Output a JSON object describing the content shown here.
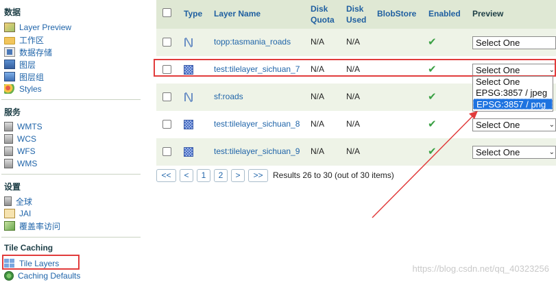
{
  "sidebar": {
    "data_section": {
      "title": "数据",
      "items": [
        {
          "label": "Layer Preview",
          "icon": "layer-preview-icon"
        },
        {
          "label": "工作区",
          "icon": "folder-icon"
        },
        {
          "label": "数据存储",
          "icon": "datastore-icon"
        },
        {
          "label": "图层",
          "icon": "layer-icon"
        },
        {
          "label": "图层组",
          "icon": "layer-group-icon"
        },
        {
          "label": "Styles",
          "icon": "styles-icon"
        }
      ]
    },
    "services_section": {
      "title": "服务",
      "items": [
        {
          "label": "WMTS",
          "icon": "service-icon"
        },
        {
          "label": "WCS",
          "icon": "service-icon"
        },
        {
          "label": "WFS",
          "icon": "service-icon"
        },
        {
          "label": "WMS",
          "icon": "service-icon"
        }
      ]
    },
    "settings_section": {
      "title": "设置",
      "items": [
        {
          "label": "全球",
          "icon": "globe-settings-icon"
        },
        {
          "label": "JAI",
          "icon": "jai-icon"
        },
        {
          "label": "覆盖率访问",
          "icon": "coverage-access-icon"
        }
      ]
    },
    "tile_section": {
      "title": "Tile Caching",
      "items": [
        {
          "label": "Tile Layers",
          "icon": "tile-layers-icon"
        },
        {
          "label": "Caching Defaults",
          "icon": "caching-defaults-icon"
        }
      ]
    }
  },
  "table": {
    "headers": {
      "type": "Type",
      "layer_name": "Layer Name",
      "disk_quota": "Disk Quota",
      "disk_used": "Disk Used",
      "blobstore": "BlobStore",
      "enabled": "Enabled",
      "preview": "Preview"
    },
    "rows": [
      {
        "name": "topp:tasmania_roads",
        "type": "vector-line",
        "disk_quota": "N/A",
        "disk_used": "N/A",
        "enabled": true,
        "preview": "Select One"
      },
      {
        "name": "test:tilelayer_sichuan_7",
        "type": "raster",
        "disk_quota": "N/A",
        "disk_used": "N/A",
        "enabled": true,
        "preview": "Select One"
      },
      {
        "name": "sf:roads",
        "type": "vector-line",
        "disk_quota": "N/A",
        "disk_used": "N/A",
        "enabled": true,
        "preview": ""
      },
      {
        "name": "test:tilelayer_sichuan_8",
        "type": "raster",
        "disk_quota": "N/A",
        "disk_used": "N/A",
        "enabled": true,
        "preview": "Select One"
      },
      {
        "name": "test:tilelayer_sichuan_9",
        "type": "raster",
        "disk_quota": "N/A",
        "disk_used": "N/A",
        "enabled": true,
        "preview": "Select One"
      }
    ],
    "dropdown_options": [
      "Select One",
      "EPSG:3857 / jpeg",
      "EPSG:3857 / png"
    ],
    "dropdown_highlighted": "EPSG:3857 / png"
  },
  "pagination": {
    "first": "<<",
    "prev": "<",
    "pages": [
      "1",
      "2"
    ],
    "next": ">",
    "last": ">>",
    "results": "Results 26 to 30 (out of 30 items)"
  },
  "watermark": "https://blog.csdn.net/qq_40323256",
  "colors": {
    "accent_red": "#e13b3b",
    "link": "#1f64a9",
    "header_bg": "#dfe8d4",
    "row_alt": "#eef3e7",
    "check": "#3aa044"
  }
}
